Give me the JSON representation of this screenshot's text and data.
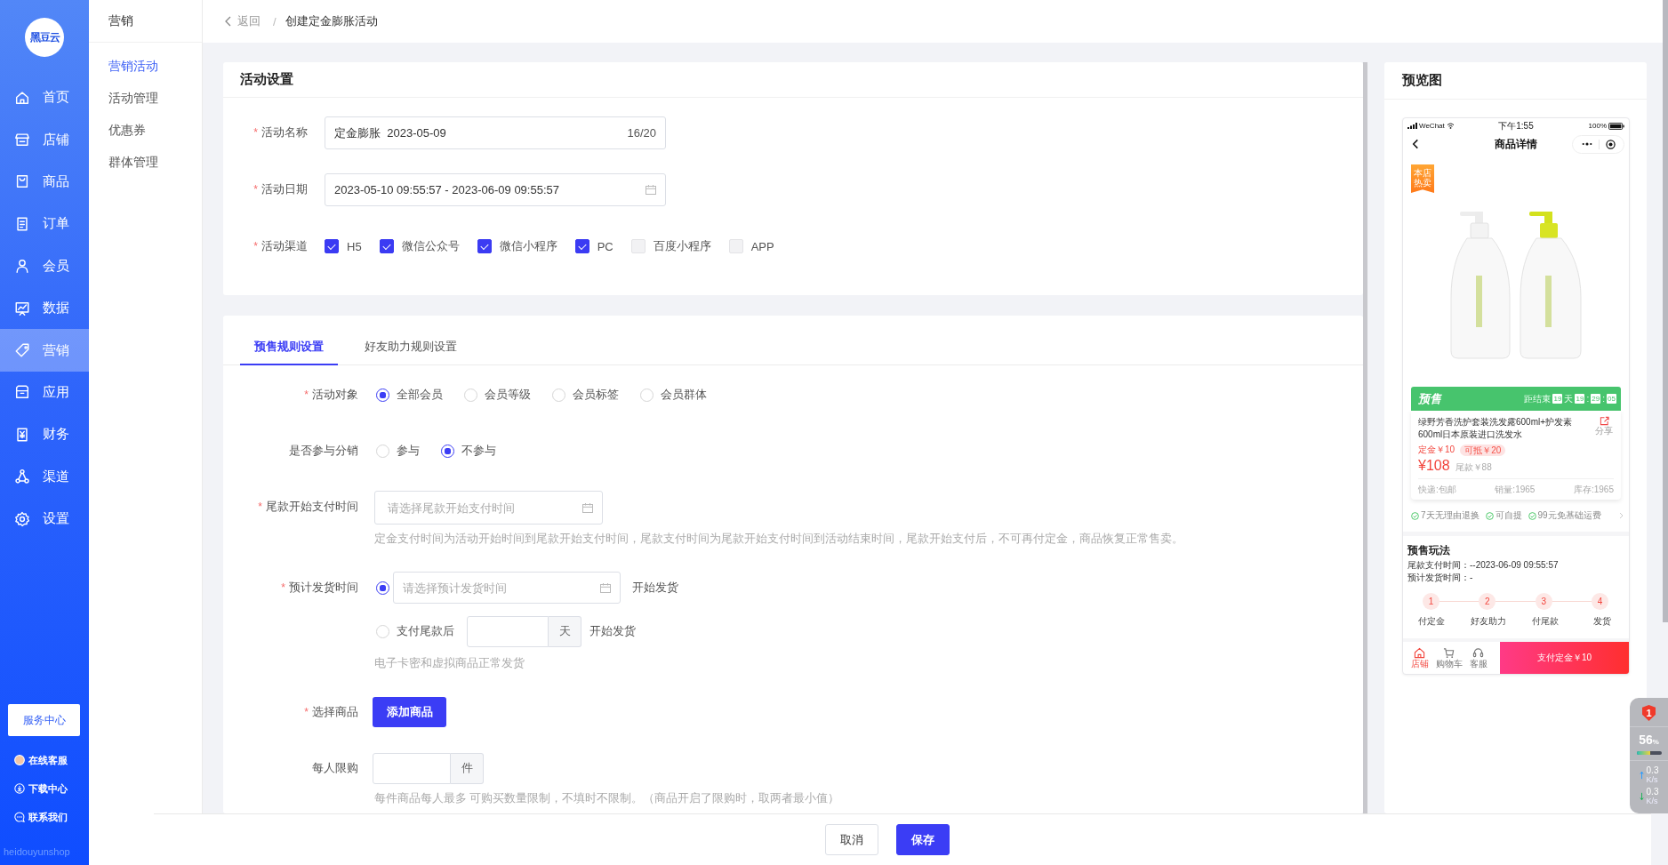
{
  "sidebar": {
    "logo": "黑豆云",
    "items": [
      {
        "label": "首页",
        "selected": false
      },
      {
        "label": "店铺",
        "selected": false
      },
      {
        "label": "商品",
        "selected": false
      },
      {
        "label": "订单",
        "selected": false
      },
      {
        "label": "会员",
        "selected": false
      },
      {
        "label": "数据",
        "selected": false
      },
      {
        "label": "营销",
        "selected": true
      },
      {
        "label": "应用",
        "selected": false
      },
      {
        "label": "财务",
        "selected": false
      },
      {
        "label": "渠道",
        "selected": false
      },
      {
        "label": "设置",
        "selected": false
      }
    ],
    "service_button": "服务中心",
    "links": [
      "在线客服",
      "下载中心",
      "联系我们"
    ],
    "brand": "heidouyunshop"
  },
  "submenu": {
    "title": "营销",
    "items": [
      {
        "label": "营销活动",
        "selected": true
      },
      {
        "label": "活动管理",
        "selected": false
      },
      {
        "label": "优惠券",
        "selected": false
      },
      {
        "label": "群体管理",
        "selected": false
      }
    ]
  },
  "breadcrumb": {
    "back": "返回",
    "separator": "/",
    "current": "创建定金膨胀活动"
  },
  "settings_card": {
    "title": "活动设置",
    "fields": [
      {
        "kind": "text",
        "asterisk": "*",
        "label": "活动名称",
        "value": "定金膨胀  2023-05-09",
        "counter": "16/20"
      },
      {
        "kind": "date",
        "asterisk": "*",
        "label": "活动日期",
        "value": "2023-05-10 09:55:57 - 2023-06-09 09:55:57"
      },
      {
        "kind": "checkboxes",
        "asterisk": "*",
        "label": "活动渠道",
        "options": [
          {
            "label": "H5",
            "checked": true
          },
          {
            "label": "微信公众号",
            "checked": true
          },
          {
            "label": "微信小程序",
            "checked": true
          },
          {
            "label": "PC",
            "checked": true
          },
          {
            "label": "百度小程序",
            "checked": false
          },
          {
            "label": "APP",
            "checked": false
          }
        ]
      }
    ]
  },
  "rules_card": {
    "tabs": [
      {
        "label": "预售规则设置",
        "selected": true
      },
      {
        "label": "好友助力规则设置",
        "selected": false
      }
    ],
    "fields": [
      {
        "kind": "radios",
        "asterisk": "*",
        "label": "活动对象",
        "options": [
          {
            "label": "全部会员",
            "selected": true
          },
          {
            "label": "会员等级",
            "selected": false
          },
          {
            "label": "会员标签",
            "selected": false
          },
          {
            "label": "会员群体",
            "selected": false
          }
        ]
      },
      {
        "kind": "radios",
        "label": "是否参与分销",
        "options": [
          {
            "label": "参与",
            "selected": false
          },
          {
            "label": "不参与",
            "selected": true
          }
        ]
      },
      {
        "kind": "date",
        "asterisk": "*",
        "label": "尾款开始支付时间",
        "placeholder": "请选择尾款开始支付时间",
        "hint": "定金支付时间为活动开始时间到尾款开始支付时间，尾款支付时间为尾款开始支付时间到活动结束时间，尾款开始支付后，不可再付定金，商品恢复正常售卖。"
      },
      {
        "kind": "delivery",
        "asterisk": "*",
        "label": "预计发货时间",
        "options": [
          {
            "kind": "date",
            "selected": true,
            "placeholder": "请选择预计发货时间",
            "suffix": "开始发货"
          },
          {
            "kind": "days",
            "selected": false,
            "label": "支付尾款后",
            "unit": "天",
            "suffix": "开始发货"
          }
        ],
        "hint": "电子卡密和虚拟商品正常发货"
      },
      {
        "kind": "button",
        "asterisk": "*",
        "label": "选择商品",
        "button": "添加商品"
      },
      {
        "kind": "number",
        "label": "每人限购",
        "unit": "件",
        "hint": "每件商品每人最多 可购买数量限制，不填时不限制。（商品开启了限购时，取两者最小值）"
      }
    ]
  },
  "footer": {
    "buttons": [
      {
        "label": "取消",
        "kind": "default"
      },
      {
        "label": "保存",
        "kind": "primary"
      }
    ]
  },
  "preview": {
    "title": "预览图",
    "phone": {
      "status": {
        "carrier": "WeChat",
        "time": "下午1:55",
        "battery": "100%"
      },
      "title": "商品详情",
      "badge": "本店热卖",
      "presale": {
        "label": "预售",
        "countdown": [
          {
            "kind": "text",
            "text": "距结束"
          },
          {
            "kind": "digits",
            "text": "19"
          },
          {
            "kind": "text",
            "text": "天"
          },
          {
            "kind": "digits",
            "text": "19"
          },
          {
            "kind": "text",
            "text": ":"
          },
          {
            "kind": "digits",
            "text": "29"
          },
          {
            "kind": "text",
            "text": ":"
          },
          {
            "kind": "digits",
            "text": "05"
          }
        ]
      },
      "product": {
        "title": "绿野芳香洗护套装洗发露600ml+护发素600ml日本原装进口洗发水",
        "share": "分享",
        "deposit": "定金￥10",
        "deduction": "可抵￥20",
        "price": "¥108",
        "balance": "尾款￥88",
        "stats": [
          "快递:包邮",
          "销量:1965",
          "库存:1965"
        ]
      },
      "services": [
        "7天无理由退换",
        "可自提",
        "99元免基础运费"
      ],
      "rules": {
        "title": "预售玩法",
        "lines": [
          "尾款支付时间：--2023-06-09 09:55:57",
          "预计发货时间：-"
        ],
        "steps": [
          {
            "number": "1",
            "label": "付定金"
          },
          {
            "number": "2",
            "label": "好友助力"
          },
          {
            "number": "3",
            "label": "付尾款"
          },
          {
            "number": "4",
            "label": "发货"
          }
        ]
      },
      "tabbar": {
        "items": [
          {
            "label": "店铺",
            "selected": true
          },
          {
            "label": "购物车",
            "selected": false
          },
          {
            "label": "客服",
            "selected": false
          }
        ],
        "button": "支付定金￥10"
      }
    }
  },
  "monitor": {
    "badge": "1",
    "percent": "56",
    "unit": "%",
    "level": 0.56,
    "speeds": [
      {
        "kind": "up",
        "value": "0.3",
        "unit": "K/s"
      },
      {
        "kind": "down",
        "value": "0.3",
        "unit": "K/s"
      }
    ]
  }
}
